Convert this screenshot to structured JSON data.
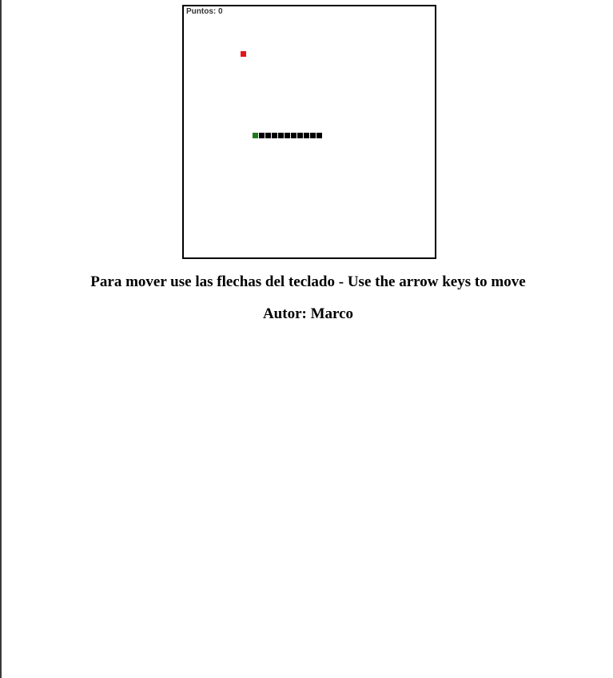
{
  "game": {
    "score_text": "Puntos: 0",
    "snake_length": 11,
    "colors": {
      "food": "#e2161c",
      "snake_head": "#1f7a1f",
      "snake_body": "#000000",
      "board_border": "#000000"
    }
  },
  "instructions": "Para mover use las flechas del teclado - Use the arrow keys to move",
  "author": "Autor: Marco"
}
